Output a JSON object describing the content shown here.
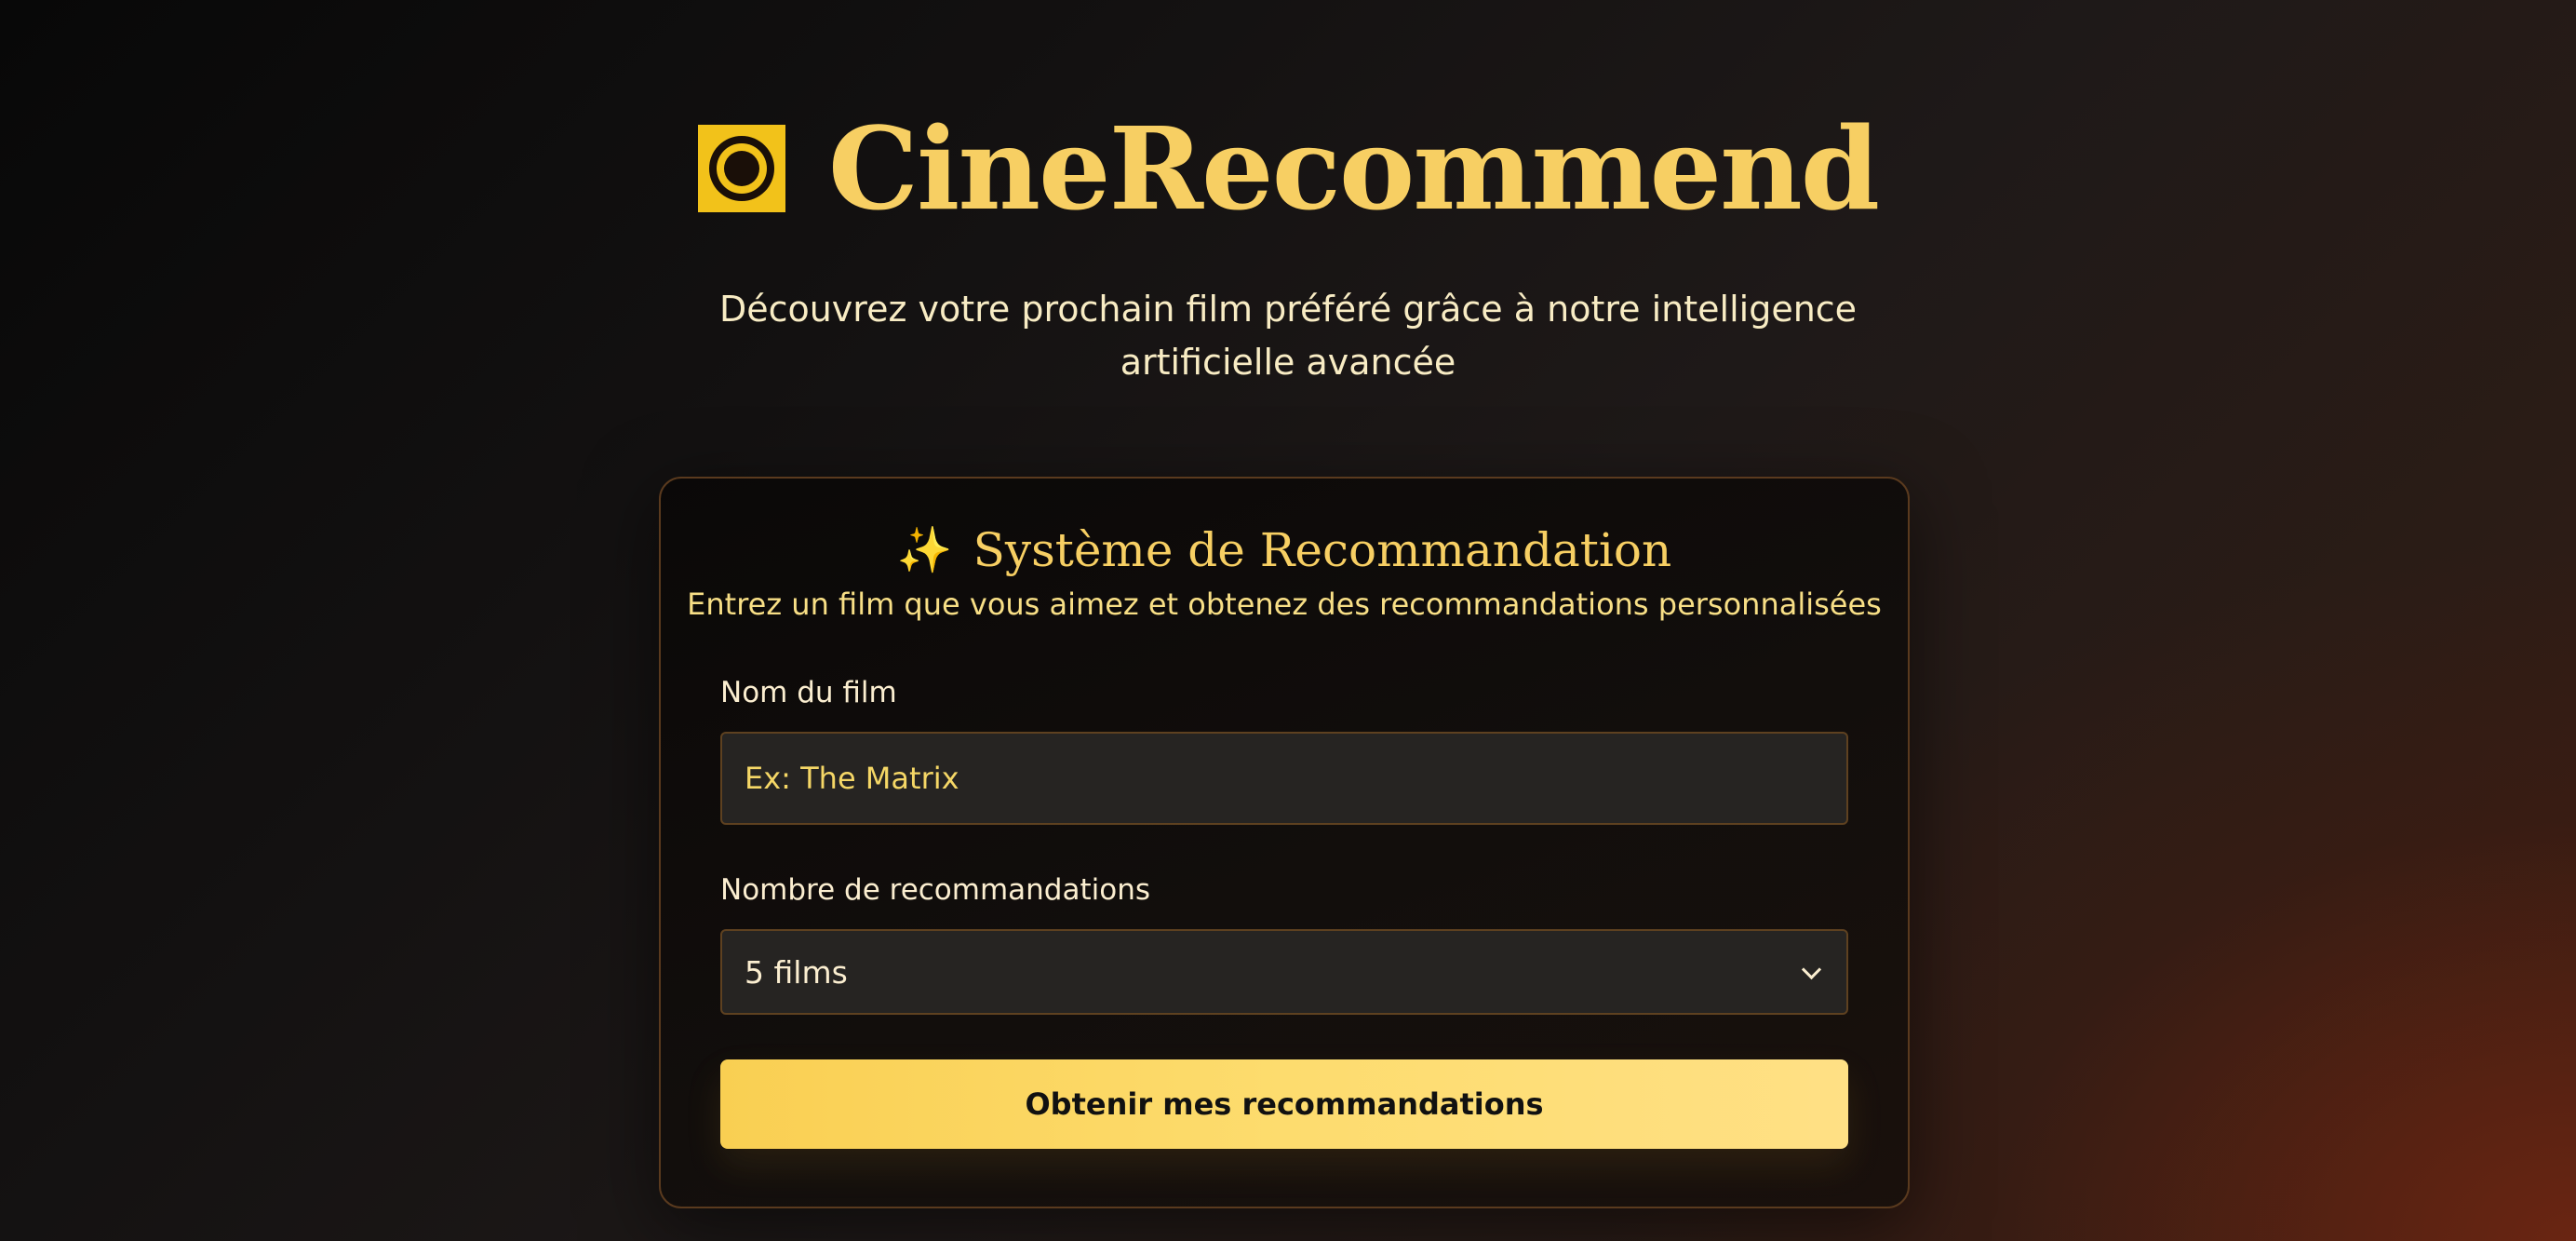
{
  "header": {
    "title": "CineRecommend",
    "logo_icon": "film-frame-icon",
    "tagline_line1": "Découvrez votre prochain film préféré grâce à notre intelligence",
    "tagline_line2": "artificielle avancée"
  },
  "card": {
    "icon": "sparkles-icon",
    "icon_glyph": "✨",
    "title": "Système de Recommandation",
    "subtitle": "Entrez un film que vous aimez et obtenez des recommandations personnalisées",
    "film_field": {
      "label": "Nom du film",
      "placeholder": "Ex: The Matrix",
      "value": ""
    },
    "count_field": {
      "label": "Nombre de recommandations",
      "selected": "5 films"
    },
    "submit_label": "Obtenir mes recommandations"
  },
  "colors": {
    "accent": "#f7cf63",
    "button": "#fcd75f",
    "card_border": "#5a3a1e",
    "field_bg": "#262422"
  }
}
